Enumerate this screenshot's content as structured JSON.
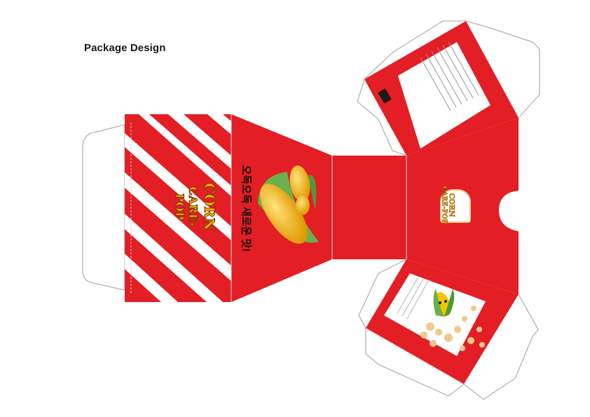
{
  "title": "Package Design",
  "brand": {
    "line1": "CORN",
    "line2": "CARE-POP"
  },
  "slogan": "오독오독 새로운 맛!",
  "colors": {
    "red": "#e31e24",
    "white": "#ffffff",
    "outline": "#b3b3b3",
    "kernel": "#f5b400",
    "husk": "#6ab04c"
  },
  "icons": [
    "corn-cob-image",
    "popcorn-image",
    "corn-mascot-image"
  ]
}
